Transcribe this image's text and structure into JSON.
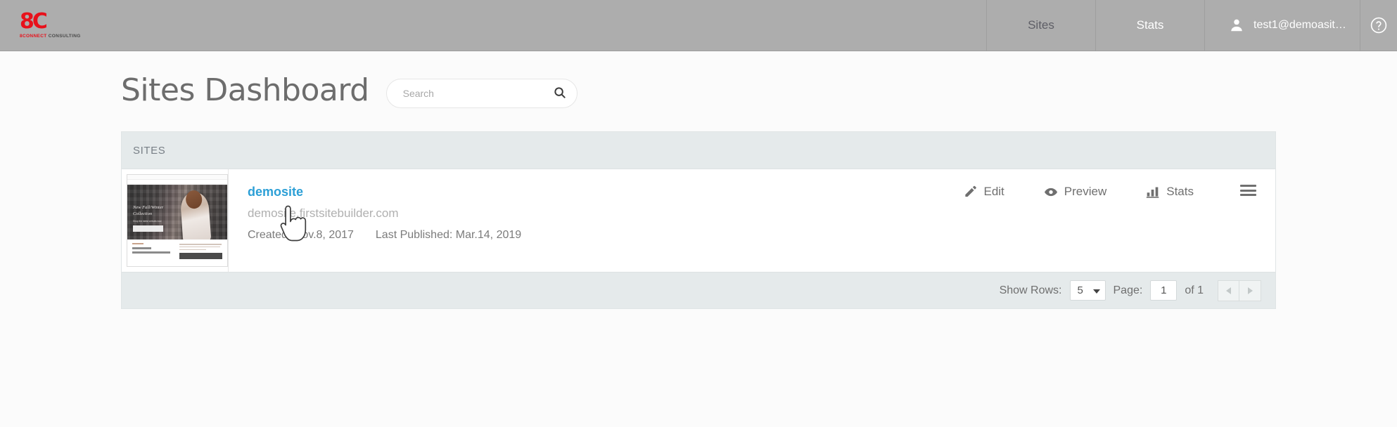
{
  "header": {
    "brand": {
      "mark": "8C",
      "sub_red": "8CONNECT",
      "sub_dark": " CONSULTING"
    },
    "nav": [
      {
        "label": "Sites",
        "name": "nav-sites",
        "active": true
      },
      {
        "label": "Stats",
        "name": "nav-stats",
        "active": false
      }
    ],
    "user": {
      "label": "test1@demoasit…",
      "avatar_icon": "user-avatar-icon"
    },
    "help": {
      "icon": "help-circle-icon",
      "label": "?"
    }
  },
  "page": {
    "title": "Sites Dashboard"
  },
  "search": {
    "placeholder": "Search",
    "value": "",
    "icon": "search-icon"
  },
  "panel": {
    "title": "SITES"
  },
  "site": {
    "name": "demosite",
    "url": "demosite.firstsitebuilder.com",
    "created_label": "Created: Nov.8, 2017",
    "published_label": "Last Published: Mar.14, 2019",
    "thumbnail": {
      "hero_line1": "New Fall/Winter",
      "hero_line2": "Collection",
      "hero_sub": "Shop the latest arrivals now",
      "body_heading1": "Hi, there",
      "body_heading2": "We're Blush Boutique."
    },
    "actions": [
      {
        "label": "Edit",
        "icon": "pencil-icon",
        "name": "edit-action"
      },
      {
        "label": "Preview",
        "icon": "eye-icon",
        "name": "preview-action"
      },
      {
        "label": "Stats",
        "icon": "bar-chart-icon",
        "name": "stats-action"
      }
    ],
    "menu_icon": "hamburger-menu-icon"
  },
  "pagination": {
    "show_rows_label": "Show Rows:",
    "rows_value": "5",
    "page_label": "Page:",
    "page_value": "1",
    "of_label": "of 1",
    "prev_icon": "chevron-left-icon",
    "next_icon": "chevron-right-icon"
  },
  "colors": {
    "header_bar": "#adadad",
    "link_blue": "#2c9fd6",
    "brand_red": "#e8111b",
    "panel_header": "#e5eaeb",
    "page_bg": "#fbfbfb"
  }
}
